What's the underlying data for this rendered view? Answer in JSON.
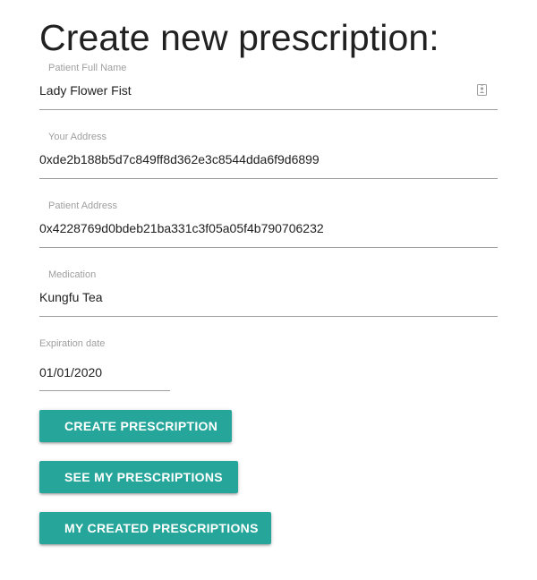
{
  "page": {
    "title": "Create new prescription:"
  },
  "form": {
    "patient_name": {
      "label": "Patient Full Name",
      "value": "Lady Flower Fist",
      "icon": "contact-card-icon"
    },
    "your_address": {
      "label": "Your Address",
      "value": "0xde2b188b5d7c849ff8d362e3c8544dda6f9d6899"
    },
    "patient_address": {
      "label": "Patient Address",
      "value": "0x4228769d0bdeb21ba331c3f05a05f4b790706232"
    },
    "medication": {
      "label": "Medication",
      "value": "Kungfu Tea"
    },
    "expiration": {
      "label": "Expiration date",
      "value": "01/01/2020"
    }
  },
  "buttons": {
    "create_label": "CREATE PRESCRIPTION",
    "see_label": "SEE MY PRESCRIPTIONS",
    "created_label": "MY CREATED PRESCRIPTIONS"
  },
  "colors": {
    "accent": "#26a69a",
    "label": "#9e9e9e",
    "text": "#212121",
    "underline": "#9e9e9e"
  }
}
